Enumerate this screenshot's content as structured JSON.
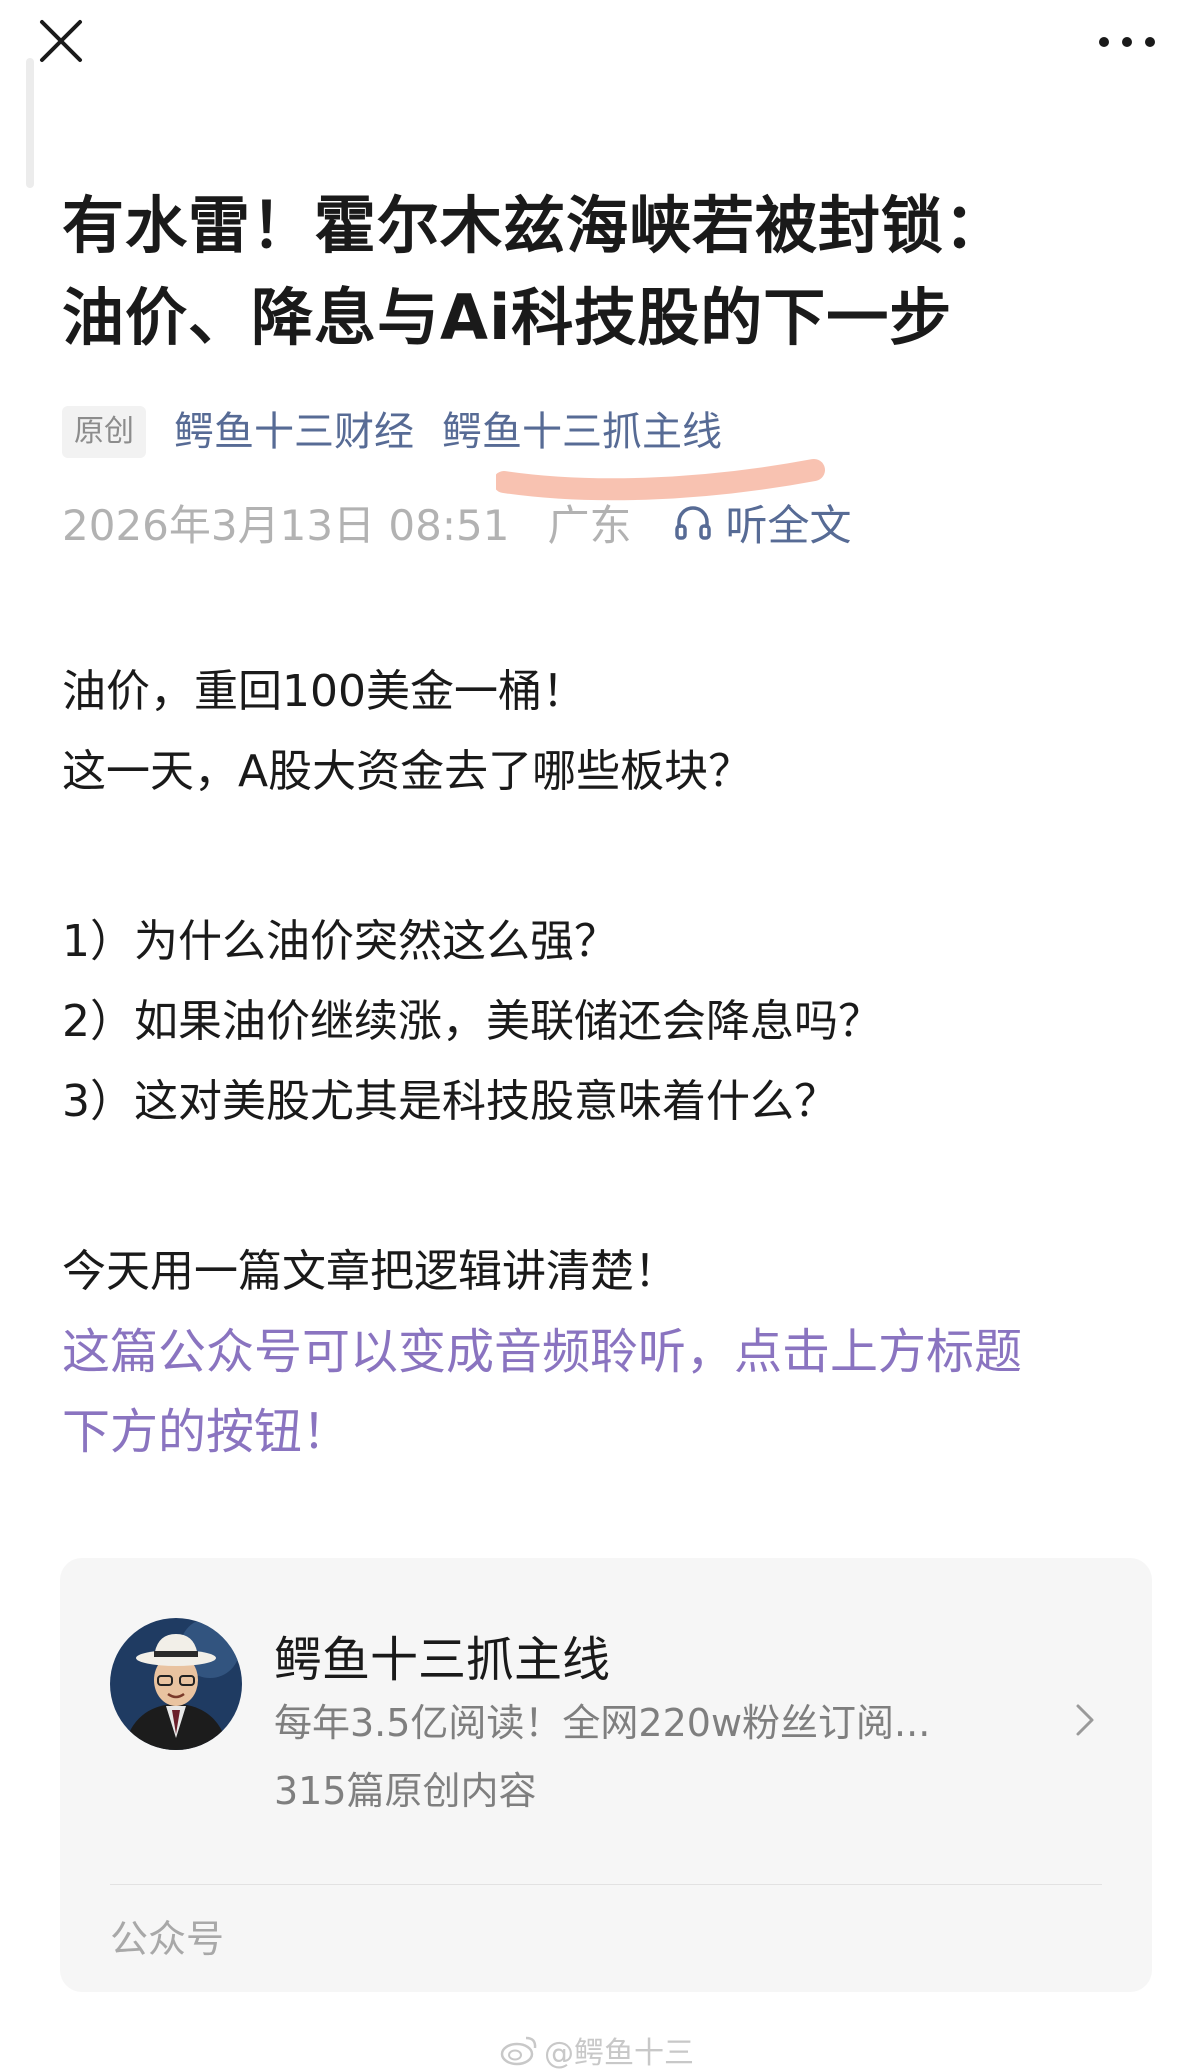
{
  "nav": {
    "close_icon": "close-icon",
    "more_icon": "more-dots-icon"
  },
  "article": {
    "title_line1": "有水雷！霍尔木兹海峡若被封锁：",
    "title_line2": "油价、降息与Ai科技股的下一步",
    "badge": "原创",
    "author1": "鳄鱼十三财经",
    "author2": "鳄鱼十三抓主线",
    "date": "2026年3月13日 08:51",
    "region": "广东",
    "listen_label": "听全文",
    "listen_icon": "headphones-icon",
    "highlight_color": "#f7b7a3"
  },
  "body": {
    "p1_line1": "油价，重回100美金一桶！",
    "p1_line2": "这一天，A股大资金去了哪些板块？",
    "q1": "1）为什么油价突然这么强？",
    "q2": "2）如果油价继续涨，美联储还会降息吗？",
    "q3": "3）这对美股尤其是科技股意味着什么？",
    "p3": "今天用一篇文章把逻辑讲清楚！",
    "purple_line1": "这篇公众号可以变成音频聆听，点击上方标题",
    "purple_line2": "下方的按钮！",
    "purple_color": "#8a74c0"
  },
  "account_card": {
    "name": "鳄鱼十三抓主线",
    "description": "每年3.5亿阅读！全网220w粉丝订阅...",
    "count": "315篇原创内容",
    "type": "公众号",
    "avatar_icon": "avatar-man-with-hat",
    "chevron_icon": "chevron-right-icon"
  },
  "watermark": {
    "text": "@鳄鱼十三",
    "icon": "weibo-icon"
  }
}
